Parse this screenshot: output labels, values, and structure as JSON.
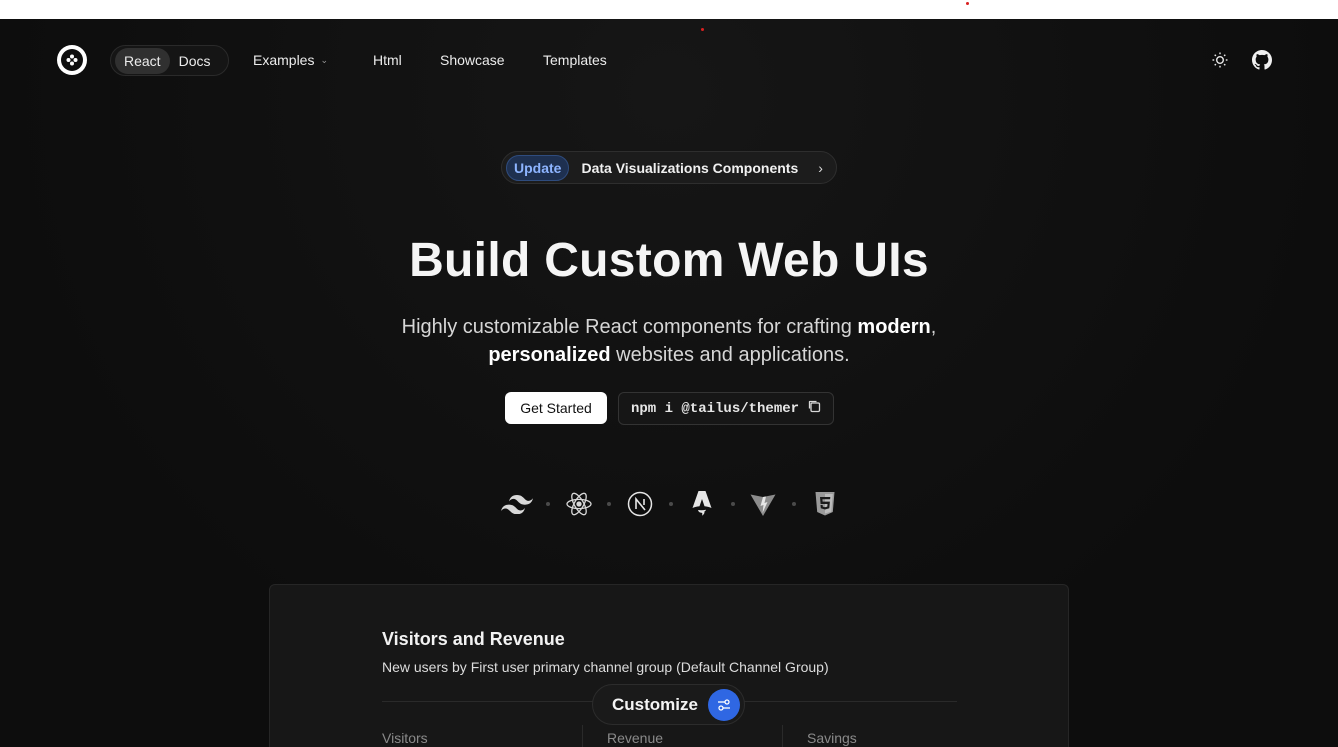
{
  "nav": {
    "segment": {
      "react": "React",
      "docs": "Docs"
    },
    "links": {
      "examples": "Examples",
      "html": "Html",
      "showcase": "Showcase",
      "templates": "Templates"
    },
    "icons": {
      "logo": "tailus-logo-icon",
      "theme": "sun-icon",
      "github": "github-icon"
    }
  },
  "hero": {
    "badge_tag": "Update",
    "badge_text": "Data Visualizations Components",
    "title": "Build Custom Web UIs",
    "subtitle": {
      "part1": "Highly customizable React components for crafting ",
      "bold1": "modern",
      "part2": ",",
      "bold2": "personalized",
      "part3": " websites and applications."
    },
    "cta": "Get Started",
    "npm": "npm i @tailus/themer",
    "tech_icons": [
      "tailwind-icon",
      "react-icon",
      "nextjs-icon",
      "astro-icon",
      "vite-icon",
      "html5-icon"
    ]
  },
  "card": {
    "title": "Visitors and Revenue",
    "description": "New users by First user primary channel group (Default Channel Group)",
    "columns": [
      "Visitors",
      "Revenue",
      "Savings"
    ]
  },
  "customize": {
    "label": "Customize",
    "accent": "#2f67e3"
  }
}
